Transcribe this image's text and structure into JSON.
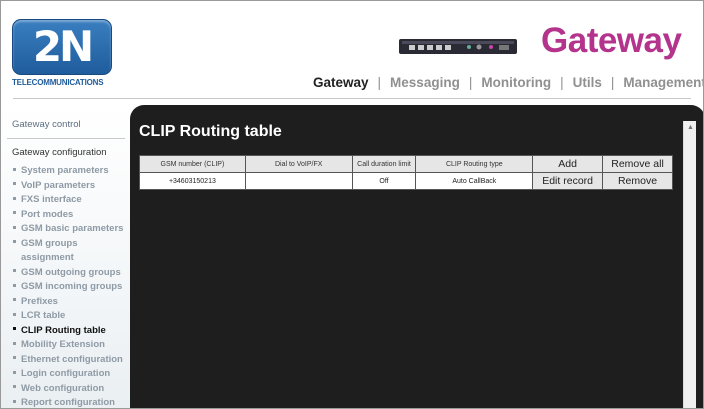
{
  "brand": {
    "logo_text": "2N",
    "logo_sub": "TELECOMMUNICATIONS",
    "product": "Gateway"
  },
  "topnav": [
    {
      "label": "Gateway",
      "active": true
    },
    {
      "label": "Messaging",
      "active": false
    },
    {
      "label": "Monitoring",
      "active": false
    },
    {
      "label": "Utils",
      "active": false
    },
    {
      "label": "Management",
      "active": false
    }
  ],
  "sidebar": {
    "gateway_control": "Gateway control",
    "gateway_configuration": "Gateway configuration",
    "items": [
      {
        "label": "System parameters"
      },
      {
        "label": "VoIP parameters"
      },
      {
        "label": "FXS interface"
      },
      {
        "label": "Port modes"
      },
      {
        "label": "GSM basic parameters"
      },
      {
        "label": "GSM groups assignment"
      },
      {
        "label": "GSM outgoing groups"
      },
      {
        "label": "GSM incoming groups"
      },
      {
        "label": "Prefixes"
      },
      {
        "label": "LCR table"
      },
      {
        "label": "CLIP Routing table"
      },
      {
        "label": "Mobility Extension"
      },
      {
        "label": "Ethernet configuration"
      },
      {
        "label": "Login configuration"
      },
      {
        "label": "Web configuration"
      },
      {
        "label": "Report configuration"
      }
    ],
    "active_index": 10
  },
  "main": {
    "title": "CLIP Routing table",
    "table": {
      "headers": [
        "GSM number (CLIP)",
        "Dial to VoIP/FX",
        "Call duration limit",
        "CLIP Routing type"
      ],
      "header_buttons": {
        "add": "Add",
        "remove_all": "Remove all"
      },
      "rows": [
        {
          "gsm_number": "+34603150213",
          "dial_to": "",
          "duration_limit": "Off",
          "routing_type": "Auto CallBack",
          "edit": "Edit record",
          "remove": "Remove"
        }
      ]
    }
  },
  "colors": {
    "accent": "#b4338c",
    "logo_blue": "#1f5c9c",
    "panel_bg": "#1e1e1e"
  }
}
